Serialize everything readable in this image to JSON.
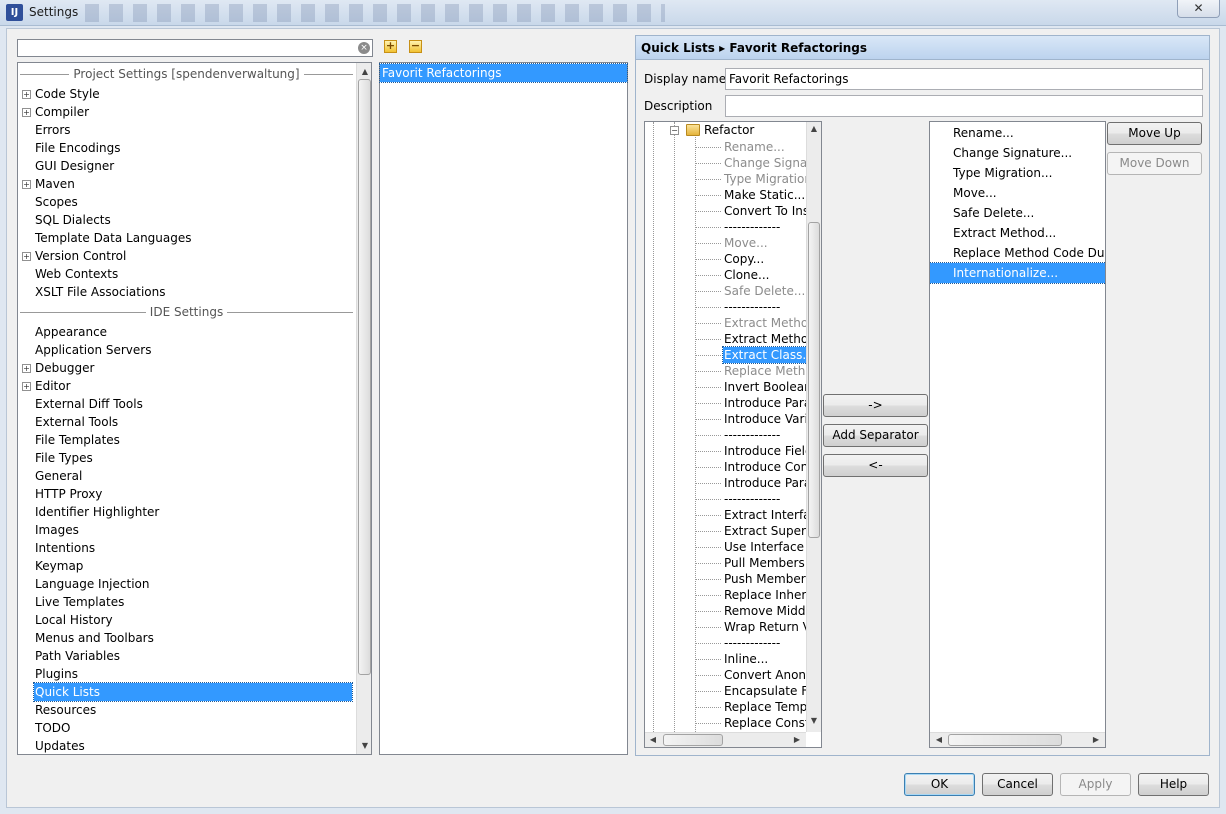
{
  "window": {
    "title": "Settings",
    "app_icon": "intellij-idea-icon",
    "close_glyph": "✕"
  },
  "search": {
    "value": "",
    "placeholder": "",
    "clear_glyph": "×"
  },
  "left_tree": {
    "project_section": "Project Settings [spendenverwaltung]",
    "project_items": [
      {
        "label": "Code Style",
        "expandable": true
      },
      {
        "label": "Compiler",
        "expandable": true
      },
      {
        "label": "Errors",
        "expandable": false
      },
      {
        "label": "File Encodings",
        "expandable": false
      },
      {
        "label": "GUI Designer",
        "expandable": false
      },
      {
        "label": "Maven",
        "expandable": true
      },
      {
        "label": "Scopes",
        "expandable": false
      },
      {
        "label": "SQL Dialects",
        "expandable": false
      },
      {
        "label": "Template Data Languages",
        "expandable": false
      },
      {
        "label": "Version Control",
        "expandable": true
      },
      {
        "label": "Web Contexts",
        "expandable": false
      },
      {
        "label": "XSLT File Associations",
        "expandable": false
      }
    ],
    "ide_section": "IDE Settings",
    "ide_items": [
      {
        "label": "Appearance",
        "expandable": false
      },
      {
        "label": "Application Servers",
        "expandable": false
      },
      {
        "label": "Debugger",
        "expandable": true
      },
      {
        "label": "Editor",
        "expandable": true
      },
      {
        "label": "External Diff Tools",
        "expandable": false
      },
      {
        "label": "External Tools",
        "expandable": false
      },
      {
        "label": "File Templates",
        "expandable": false
      },
      {
        "label": "File Types",
        "expandable": false
      },
      {
        "label": "General",
        "expandable": false
      },
      {
        "label": "HTTP Proxy",
        "expandable": false
      },
      {
        "label": "Identifier Highlighter",
        "expandable": false
      },
      {
        "label": "Images",
        "expandable": false
      },
      {
        "label": "Intentions",
        "expandable": false
      },
      {
        "label": "Keymap",
        "expandable": false
      },
      {
        "label": "Language Injection",
        "expandable": false
      },
      {
        "label": "Live Templates",
        "expandable": false
      },
      {
        "label": "Local History",
        "expandable": false
      },
      {
        "label": "Menus and Toolbars",
        "expandable": false
      },
      {
        "label": "Path Variables",
        "expandable": false
      },
      {
        "label": "Plugins",
        "expandable": false
      },
      {
        "label": "Quick Lists",
        "expandable": false,
        "selected": true
      },
      {
        "label": "Resources",
        "expandable": false
      },
      {
        "label": "TODO",
        "expandable": false
      },
      {
        "label": "Updates",
        "expandable": false
      }
    ]
  },
  "quick_lists": {
    "add_glyph": "+",
    "remove_glyph": "−",
    "items": [
      {
        "label": "Favorit Refactorings",
        "selected": true
      }
    ]
  },
  "editor": {
    "breadcrumb_root": "Quick Lists",
    "breadcrumb_sep": "▸",
    "breadcrumb_leaf": "Favorit Refactorings",
    "display_name_label": "Display name",
    "display_name_value": "Favorit Refactorings",
    "description_label": "Description",
    "description_value": ""
  },
  "action_tree": {
    "folder": "Refactor",
    "items": [
      {
        "label": "Rename...",
        "disabled": true
      },
      {
        "label": "Change Signatu",
        "disabled": true
      },
      {
        "label": "Type Migration",
        "disabled": true
      },
      {
        "label": "Make Static...",
        "disabled": false
      },
      {
        "label": "Convert To Inst",
        "disabled": false
      },
      {
        "label": "-------------",
        "disabled": false
      },
      {
        "label": "Move...",
        "disabled": true
      },
      {
        "label": "Copy...",
        "disabled": false
      },
      {
        "label": "Clone...",
        "disabled": false
      },
      {
        "label": "Safe Delete...",
        "disabled": true
      },
      {
        "label": "-------------",
        "disabled": false
      },
      {
        "label": "Extract Method",
        "disabled": true
      },
      {
        "label": "Extract Method",
        "disabled": false
      },
      {
        "label": "Extract Class...",
        "disabled": false,
        "selected": true
      },
      {
        "label": "Replace Metho",
        "disabled": true
      },
      {
        "label": "Invert Boolean.",
        "disabled": false
      },
      {
        "label": "Introduce Parar",
        "disabled": false
      },
      {
        "label": "Introduce Varia",
        "disabled": false
      },
      {
        "label": "-------------",
        "disabled": false
      },
      {
        "label": "Introduce Field",
        "disabled": false
      },
      {
        "label": "Introduce Cons",
        "disabled": false
      },
      {
        "label": "Introduce Parar",
        "disabled": false
      },
      {
        "label": "-------------",
        "disabled": false
      },
      {
        "label": "Extract Interfac",
        "disabled": false
      },
      {
        "label": "Extract Supercla",
        "disabled": false
      },
      {
        "label": "Use Interface W",
        "disabled": false
      },
      {
        "label": "Pull Members U",
        "disabled": false
      },
      {
        "label": "Push Members",
        "disabled": false
      },
      {
        "label": "Replace Inherit",
        "disabled": false
      },
      {
        "label": "Remove Middle",
        "disabled": false
      },
      {
        "label": "Wrap Return Va",
        "disabled": false
      },
      {
        "label": "-------------",
        "disabled": false
      },
      {
        "label": "Inline...",
        "disabled": false
      },
      {
        "label": "Convert Anony",
        "disabled": false
      },
      {
        "label": "Encapsulate Fie",
        "disabled": false
      },
      {
        "label": "Replace Temp v",
        "disabled": false
      },
      {
        "label": "Replace Constr",
        "disabled": false
      }
    ]
  },
  "transfer": {
    "add": "->",
    "add_separator": "Add Separator",
    "remove": "<-"
  },
  "selected_actions": {
    "items": [
      {
        "label": "Rename...",
        "selected": false
      },
      {
        "label": "Change Signature...",
        "selected": false
      },
      {
        "label": "Type Migration...",
        "selected": false
      },
      {
        "label": "Move...",
        "selected": false
      },
      {
        "label": "Safe Delete...",
        "selected": false
      },
      {
        "label": "Extract Method...",
        "selected": false
      },
      {
        "label": "Replace Method Code Duplic",
        "selected": false
      },
      {
        "label": "Internationalize...",
        "selected": true
      }
    ]
  },
  "order": {
    "move_up": "Move Up",
    "move_down": "Move Down"
  },
  "dialog": {
    "ok": "OK",
    "cancel": "Cancel",
    "apply": "Apply",
    "help": "Help"
  }
}
